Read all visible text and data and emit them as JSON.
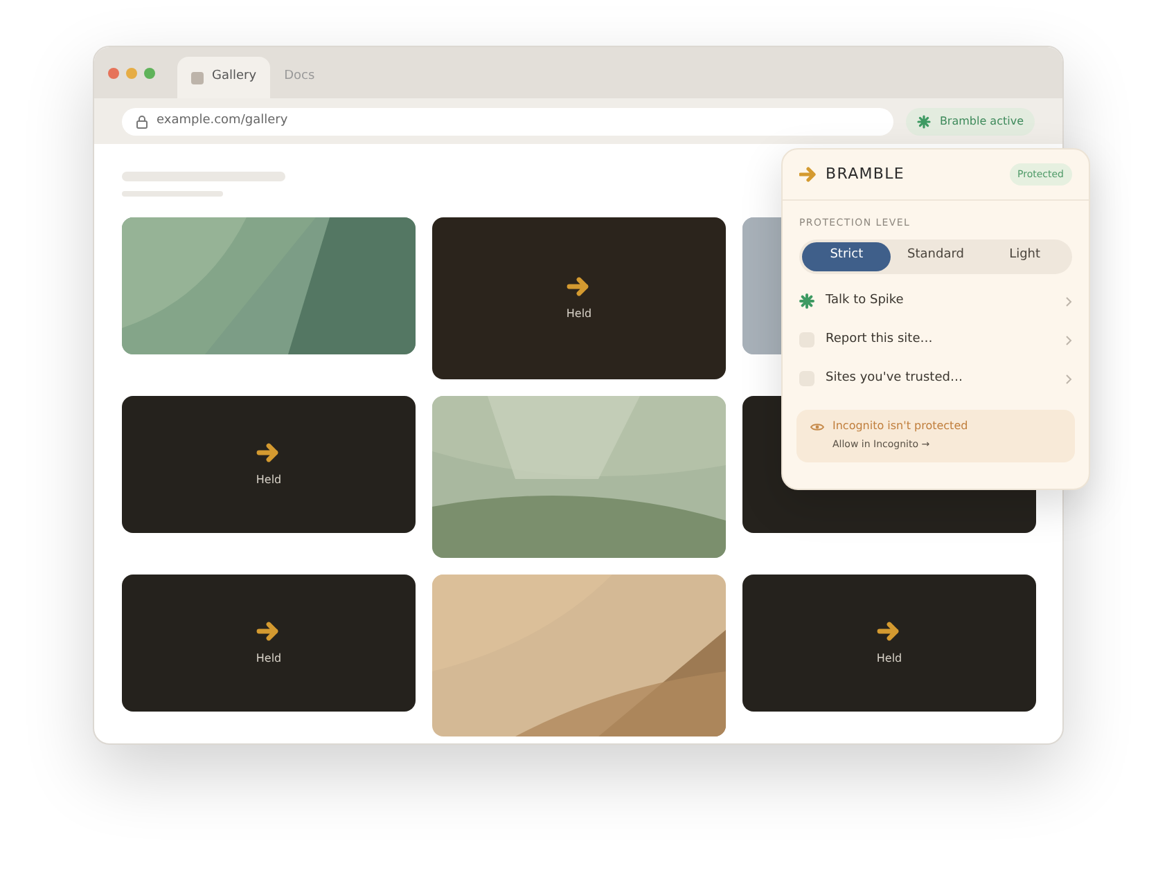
{
  "browser": {
    "tabs": [
      {
        "label": "Gallery",
        "selected": true
      },
      {
        "label": "Docs",
        "selected": false
      }
    ],
    "address": "example.com/gallery",
    "extension_badge": "Bramble active"
  },
  "gallery": {
    "tiles": [
      {
        "kind": "picture"
      },
      {
        "kind": "held",
        "label": "Held"
      },
      {
        "kind": "picture"
      },
      {
        "kind": "held",
        "label": "Held"
      },
      {
        "kind": "picture"
      },
      {
        "kind": "held"
      },
      {
        "kind": "held",
        "label": "Held"
      },
      {
        "kind": "picture"
      },
      {
        "kind": "held",
        "label": "Held"
      }
    ]
  },
  "popup": {
    "brand": "BRAMBLE",
    "status": "Protected",
    "section_label": "PROTECTION LEVEL",
    "levels": [
      {
        "label": "Strict",
        "selected": true
      },
      {
        "label": "Standard",
        "selected": false
      },
      {
        "label": "Light",
        "selected": false
      }
    ],
    "menu": [
      {
        "kind": "spike",
        "label": "Talk to Spike"
      },
      {
        "kind": "plain",
        "label": "Report this site…"
      },
      {
        "kind": "plain",
        "label": "Sites you've trusted…"
      }
    ],
    "notice": {
      "title": "Incognito isn't protected",
      "link": "Allow in Incognito →"
    }
  }
}
